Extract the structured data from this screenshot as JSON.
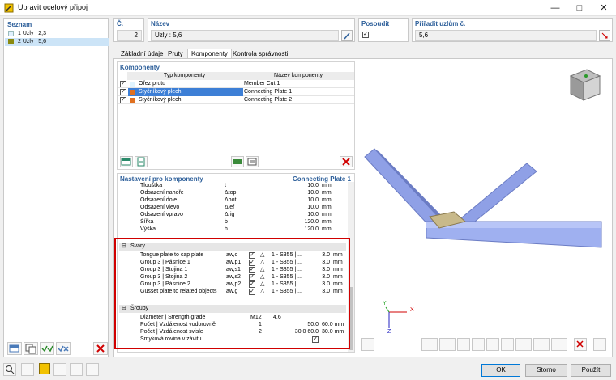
{
  "window": {
    "title": "Upravit ocelový připoj",
    "icon": "connection-icon"
  },
  "list": {
    "header": "Seznam",
    "items": [
      {
        "label": "1  Uzly : 2,3",
        "color": "#e0f0ff"
      },
      {
        "label": "2  Uzly : 5,6",
        "color": "#8a8a10",
        "selected": true
      }
    ]
  },
  "fields": {
    "number_label": "Č.",
    "number_value": "2",
    "name_label": "Název",
    "name_value": "Uzly : 5,6",
    "assess_label": "Posoudit",
    "assess_checked": true,
    "assign_label": "Přiřadit uzlům č.",
    "assign_value": "5,6"
  },
  "tabs": [
    "Základní údaje",
    "Pruty",
    "Komponenty",
    "Kontrola správnosti"
  ],
  "active_tab": 2,
  "components": {
    "header": "Komponenty",
    "col_type": "Typ komponenty",
    "col_name": "Název komponenty",
    "rows": [
      {
        "type": "Ořez prutu",
        "name": "Member Cut 1",
        "color": "#e0f4ff",
        "checked": true
      },
      {
        "type": "Styčníkový plech",
        "name": "Connecting Plate 1",
        "color": "#e07020",
        "checked": true,
        "selected": true
      },
      {
        "type": "Styčníkový plech",
        "name": "Connecting Plate 2",
        "color": "#e07020",
        "checked": true
      }
    ]
  },
  "settings": {
    "header": "Nastavení pro komponenty",
    "right": "Connecting Plate 1",
    "params": [
      {
        "name": "Tloušťka",
        "sym": "t",
        "value": "10.0",
        "unit": "mm"
      },
      {
        "name": "Odsazení nahoře",
        "sym": "Δtop",
        "value": "10.0",
        "unit": "mm"
      },
      {
        "name": "Odsazení dole",
        "sym": "Δbot",
        "value": "10.0",
        "unit": "mm"
      },
      {
        "name": "Odsazení vlevo",
        "sym": "Δlef",
        "value": "10.0",
        "unit": "mm"
      },
      {
        "name": "Odsazení vpravo",
        "sym": "Δrig",
        "value": "10.0",
        "unit": "mm"
      },
      {
        "name": "Šířka",
        "sym": "b",
        "value": "120.0",
        "unit": "mm"
      },
      {
        "name": "Výška",
        "sym": "h",
        "value": "120.0",
        "unit": "mm"
      }
    ],
    "welds_group": "Svary",
    "welds": [
      {
        "name": "Tongue plate to cap plate",
        "sym": "aw,c",
        "mat": "1 - S355 | ...",
        "value": "3.0",
        "unit": "mm"
      },
      {
        "name": "Group 3 | Pásnice 1",
        "sym": "aw,p1",
        "mat": "1 - S355 | ...",
        "value": "3.0",
        "unit": "mm"
      },
      {
        "name": "Group 3 | Stojina 1",
        "sym": "aw,s1",
        "mat": "1 - S355 | ...",
        "value": "3.0",
        "unit": "mm"
      },
      {
        "name": "Group 3 | Stojina 2",
        "sym": "aw,s2",
        "mat": "1 - S355 | ...",
        "value": "3.0",
        "unit": "mm"
      },
      {
        "name": "Group 3 | Pásnice 2",
        "sym": "aw,p2",
        "mat": "1 - S355 | ...",
        "value": "3.0",
        "unit": "mm"
      },
      {
        "name": "Gusset plate to related objects",
        "sym": "aw,g",
        "mat": "1 - S355 | ...",
        "value": "3.0",
        "unit": "mm"
      }
    ],
    "bolts_group": "Šrouby",
    "bolts": [
      {
        "name": "Diameter | Strength grade",
        "c1": "M12",
        "c2": "4.6",
        "c3": "",
        "c4": ""
      },
      {
        "name": "Počet | Vzdálenost vodorovně",
        "c1": "1",
        "c2": "",
        "c3": "50.0",
        "c4": "60.0 mm"
      },
      {
        "name": "Počet | Vzdálenost svisle",
        "c1": "2",
        "c2": "",
        "c3": "30.0 60.0",
        "c4": "30.0 mm"
      },
      {
        "name": "Smyková rovina v závitu",
        "c1": "",
        "c2": "",
        "c3": "",
        "c4": "",
        "check": true
      }
    ]
  },
  "axes": {
    "x": "X",
    "y": "Y",
    "z": "Z"
  },
  "buttons": {
    "ok": "OK",
    "cancel": "Storno",
    "apply": "Použít"
  },
  "colors": {
    "accent": "#2d5f9a",
    "member": "#8fa0e6",
    "plate": "#c8b98a",
    "highlight": "#d00000",
    "selection": "#3d7fd6"
  }
}
